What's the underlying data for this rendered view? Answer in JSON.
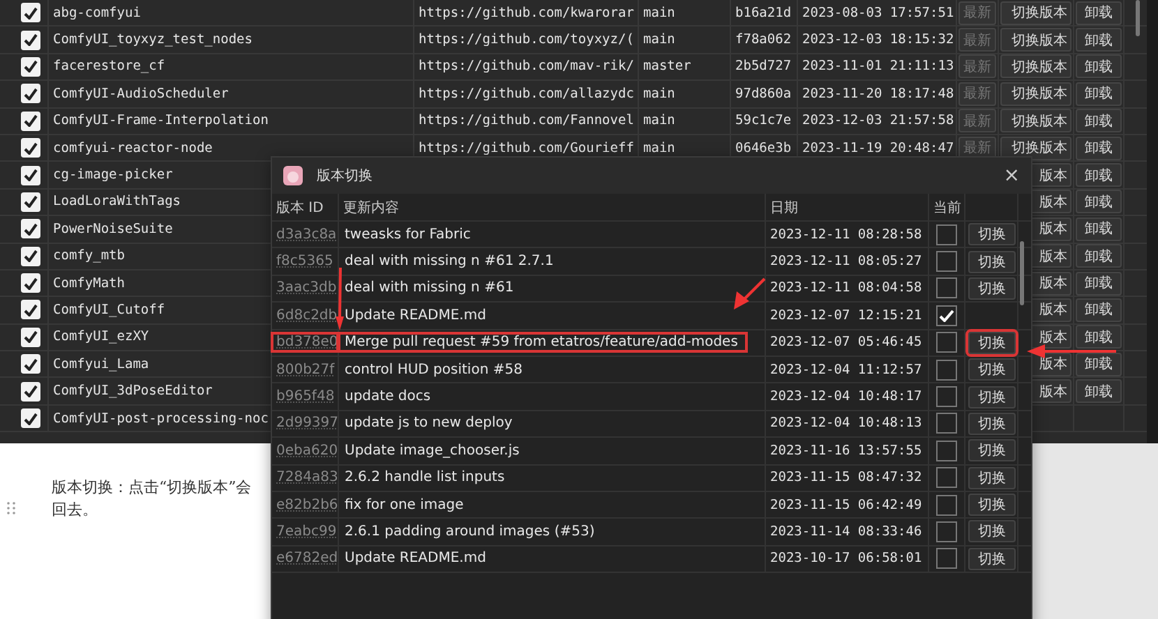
{
  "node_table": {
    "rows": [
      {
        "checked": true,
        "name": "abg-comfyui",
        "url": "https://github.com/kwarorar",
        "branch": "main",
        "commit": "b16a21d",
        "date": "2023-08-03 17:57:51",
        "latest": "最新",
        "switch": "切换版本",
        "uninstall": "卸载"
      },
      {
        "checked": true,
        "name": "ComfyUI_toyxyz_test_nodes",
        "url": "https://github.com/toyxyz/(",
        "branch": "main",
        "commit": "f78a062",
        "date": "2023-12-03 18:15:32",
        "latest": "最新",
        "switch": "切换版本",
        "uninstall": "卸载"
      },
      {
        "checked": true,
        "name": "facerestore_cf",
        "url": "https://github.com/mav-rik/",
        "branch": "master",
        "commit": "2b5d727",
        "date": "2023-11-01 21:11:13",
        "latest": "最新",
        "switch": "切换版本",
        "uninstall": "卸载"
      },
      {
        "checked": true,
        "name": "ComfyUI-AudioScheduler",
        "url": "https://github.com/allazydc",
        "branch": "main",
        "commit": "97d860a",
        "date": "2023-11-20 18:17:48",
        "latest": "最新",
        "switch": "切换版本",
        "uninstall": "卸载"
      },
      {
        "checked": true,
        "name": "ComfyUI-Frame-Interpolation",
        "url": "https://github.com/Fannovel",
        "branch": "main",
        "commit": "59c1c7e",
        "date": "2023-12-03 21:57:58",
        "latest": "最新",
        "switch": "切换版本",
        "uninstall": "卸载"
      },
      {
        "checked": true,
        "name": "comfyui-reactor-node",
        "url": "https://github.com/Gourieff",
        "branch": "main",
        "commit": "0646e3b",
        "date": "2023-11-19 20:48:47",
        "latest": "最新",
        "switch": "切换版本",
        "uninstall": "卸载"
      },
      {
        "checked": true,
        "name": "cg-image-picker",
        "switch": "版本",
        "uninstall": "卸载"
      },
      {
        "checked": true,
        "name": "LoadLoraWithTags",
        "switch": "版本",
        "uninstall": "卸载"
      },
      {
        "checked": true,
        "name": "PowerNoiseSuite",
        "switch": "版本",
        "uninstall": "卸载"
      },
      {
        "checked": true,
        "name": "comfy_mtb",
        "switch": "版本",
        "uninstall": "卸载"
      },
      {
        "checked": true,
        "name": "ComfyMath",
        "switch": "版本",
        "uninstall": "卸载"
      },
      {
        "checked": true,
        "name": "ComfyUI_Cutoff",
        "switch": "版本",
        "uninstall": "卸载"
      },
      {
        "checked": true,
        "name": "ComfyUI_ezXY",
        "switch": "版本",
        "uninstall": "卸载"
      },
      {
        "checked": true,
        "name": "Comfyui_Lama",
        "switch": "版本",
        "uninstall": "卸载"
      },
      {
        "checked": true,
        "name": "ComfyUI_3dPoseEditor",
        "switch": "版本",
        "uninstall": "卸载"
      },
      {
        "checked": true,
        "name": "ComfyUI-post-processing-noc"
      }
    ]
  },
  "document": {
    "lines": [
      "版本切换：点击“切换版本”会",
      "回去。"
    ]
  },
  "dialog": {
    "title": "版本切换",
    "close": "×",
    "columns": [
      "版本 ID",
      "更新内容",
      "日期",
      "当前"
    ],
    "rows": [
      {
        "id": "d3a3c8a",
        "message": "tweasks for Fabric",
        "date": "2023-12-11 08:28:58",
        "current": false,
        "button": "切换",
        "highlighted": false
      },
      {
        "id": "f8c5365",
        "message": "deal with missing n #61 2.7.1",
        "date": "2023-12-11 08:05:27",
        "current": false,
        "button": "切换",
        "highlighted": false
      },
      {
        "id": "3aac3db",
        "message": "deal with missing n #61",
        "date": "2023-12-11 08:04:58",
        "current": false,
        "button": "切换",
        "highlighted": false
      },
      {
        "id": "6d8c2db",
        "message": "Update README.md",
        "date": "2023-12-07 12:15:21",
        "current": true,
        "highlighted": false
      },
      {
        "id": "bd378e0",
        "message": "Merge pull request #59 from etatros/feature/add-modes",
        "date": "2023-12-07 05:46:45",
        "current": false,
        "button": "切换",
        "highlighted": true
      },
      {
        "id": "800b27f",
        "message": "control HUD position #58",
        "date": "2023-12-04 11:12:57",
        "current": false,
        "button": "切换",
        "highlighted": false
      },
      {
        "id": "b965f48",
        "message": "update docs",
        "date": "2023-12-04 10:48:17",
        "current": false,
        "button": "切换",
        "highlighted": false
      },
      {
        "id": "2d99397",
        "message": "update js to new deploy",
        "date": "2023-12-04 10:48:13",
        "current": false,
        "button": "切换",
        "highlighted": false
      },
      {
        "id": "0eba620",
        "message": "Update image_chooser.js",
        "date": "2023-11-16 13:57:55",
        "current": false,
        "button": "切换",
        "highlighted": false
      },
      {
        "id": "7284a83",
        "message": "2.6.2 handle list inputs",
        "date": "2023-11-15 08:47:32",
        "current": false,
        "button": "切换",
        "highlighted": false
      },
      {
        "id": "e82b2b6",
        "message": "fix for one image",
        "date": "2023-11-15 06:42:49",
        "current": false,
        "button": "切换",
        "highlighted": false
      },
      {
        "id": "7eabc99",
        "message": "2.6.1 padding around images (#53)",
        "date": "2023-11-14 08:33:46",
        "current": false,
        "button": "切换",
        "highlighted": false
      },
      {
        "id": "e6782ed",
        "message": "Update README.md",
        "date": "2023-10-17 06:58:01",
        "current": false,
        "button": "切换",
        "highlighted": false
      }
    ]
  }
}
